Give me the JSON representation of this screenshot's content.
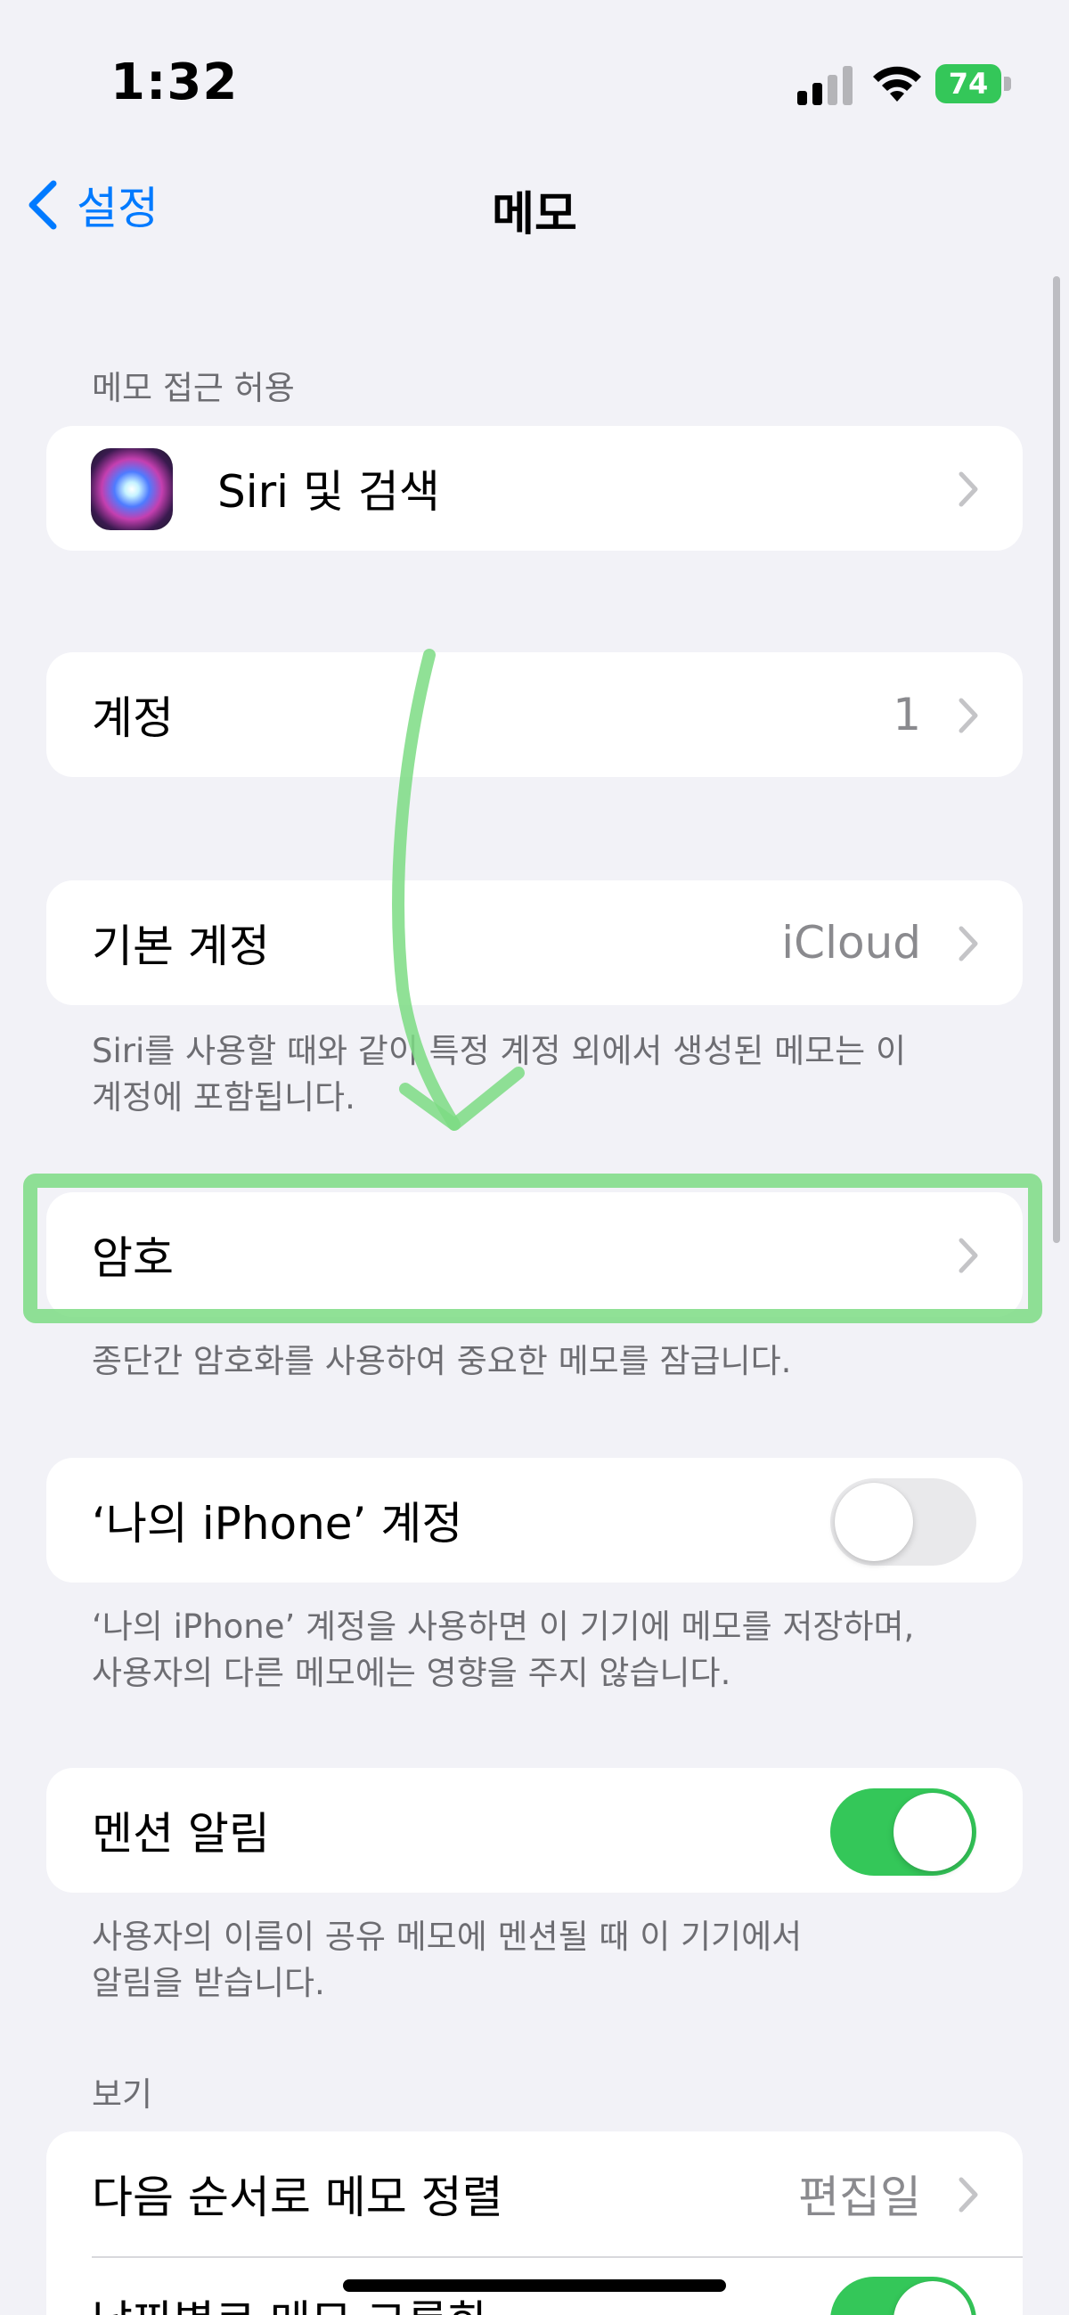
{
  "status_bar": {
    "time": "1:32",
    "battery_level": "74"
  },
  "nav": {
    "back_label": "설정",
    "title": "메모"
  },
  "sections": {
    "access_header": "메모 접근 허용",
    "siri_label": "Siri 및 검색",
    "accounts_label": "계정",
    "accounts_value": "1",
    "default_account_label": "기본 계정",
    "default_account_value": "iCloud",
    "default_account_footer_line1": "Siri를 사용할 때와 같이 특정 계정 외에서 생성된 메모는 이",
    "default_account_footer_line2": "계정에 포함됩니다.",
    "password_label": "암호",
    "password_footer": "종단간 암호화를 사용하여 중요한 메모를 잠급니다.",
    "on_my_iphone_label": "‘나의 iPhone’ 계정",
    "on_my_iphone_toggle": false,
    "on_my_iphone_footer_line1": "‘나의 iPhone’ 계정을 사용하면 이 기기에 메모를 저장하며,",
    "on_my_iphone_footer_line2": "사용자의 다른 메모에는 영향을 주지 않습니다.",
    "mentions_label": "멘션 알림",
    "mentions_toggle": true,
    "mentions_footer_line1": "사용자의 이름이 공유 메모에 멘션될 때 이 기기에서",
    "mentions_footer_line2": "알림을 받습니다.",
    "view_header": "보기",
    "sort_label": "다음 순서로 메모 정렬",
    "sort_value": "편집일",
    "group_by_date_label": "날짜별로 메모 그룹화",
    "group_by_date_toggle": true
  },
  "colors": {
    "accent": "#007aff",
    "toggle_on": "#34c759",
    "annotation": "#7ddc84",
    "background": "#f2f2f7"
  }
}
